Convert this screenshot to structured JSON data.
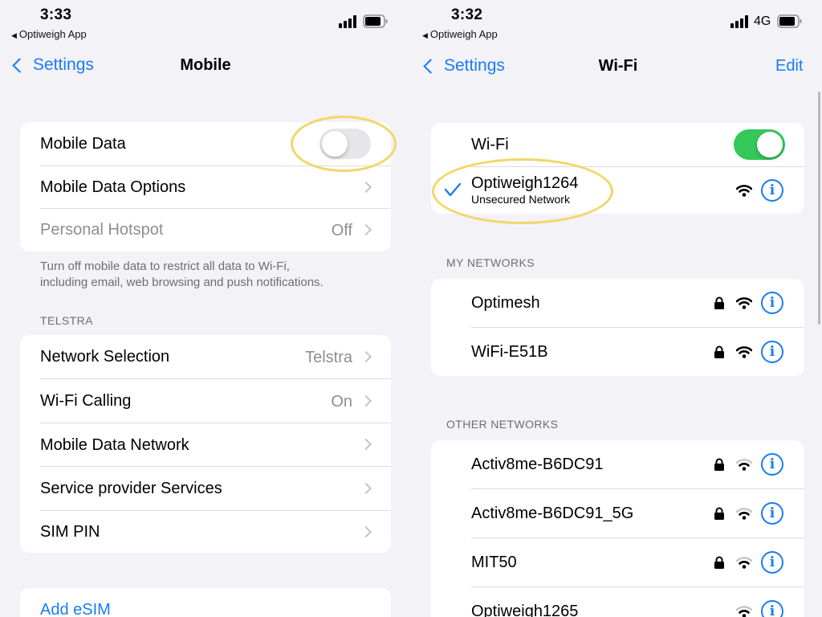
{
  "left": {
    "status": {
      "time": "3:33",
      "back_app": "Optiweigh App"
    },
    "nav": {
      "back": "Settings",
      "title": "Mobile"
    },
    "group1": {
      "rows": [
        {
          "label": "Mobile Data"
        },
        {
          "label": "Mobile Data Options"
        },
        {
          "label": "Personal Hotspot",
          "value": "Off"
        }
      ],
      "mobile_data_on": false
    },
    "footnote_line1": "Turn off mobile data to restrict all data to Wi-Fi,",
    "footnote_line2": "including email, web browsing and push notifications.",
    "section": "TELSTRA",
    "group2": {
      "rows": [
        {
          "label": "Network Selection",
          "value": "Telstra"
        },
        {
          "label": "Wi-Fi Calling",
          "value": "On"
        },
        {
          "label": "Mobile Data Network",
          "value": ""
        },
        {
          "label": "Service provider Services",
          "value": ""
        },
        {
          "label": "SIM PIN",
          "value": ""
        }
      ]
    },
    "add_esim": "Add eSIM"
  },
  "right": {
    "status": {
      "time": "3:32",
      "back_app": "Optiweigh App",
      "network": "4G"
    },
    "nav": {
      "back": "Settings",
      "title": "Wi-Fi",
      "edit": "Edit"
    },
    "wifi": {
      "label": "Wi-Fi",
      "enabled": true,
      "connected_name": "Optiweigh1264",
      "connected_sub": "Unsecured Network"
    },
    "my_networks_title": "MY NETWORKS",
    "my_networks": [
      {
        "name": "Optimesh",
        "icon": "lock-icon"
      },
      {
        "name": "WiFi-E51B",
        "icon": "lock-icon"
      }
    ],
    "other_networks_title": "OTHER NETWORKS",
    "other_networks": [
      {
        "name": "Activ8me-B6DC91",
        "icon": "lock-icon"
      },
      {
        "name": "Activ8me-B6DC91_5G",
        "icon": "lock-icon"
      },
      {
        "name": "MIT50",
        "icon": "lock-icon"
      },
      {
        "name": "Optiweigh1265"
      }
    ]
  },
  "colors": {
    "accent": "#1a7cf5",
    "toggle_on": "#34c759",
    "highlight": "#f2d766"
  },
  "info_glyph": "i"
}
